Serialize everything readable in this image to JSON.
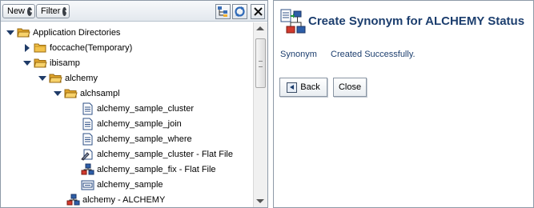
{
  "toolbar": {
    "new_label": "New",
    "filter_label": "Filter",
    "icons": [
      "tree-settings-icon",
      "refresh-icon",
      "close-icon"
    ]
  },
  "tree": {
    "items": [
      {
        "label": "Application Directories",
        "icon": "folder-open-icon",
        "twisty": "open"
      },
      {
        "label": "foccache(Temporary)",
        "icon": "folder-closed-icon",
        "twisty": "closed"
      },
      {
        "label": "ibisamp",
        "icon": "folder-open-icon",
        "twisty": "open"
      },
      {
        "label": "alchemy",
        "icon": "folder-open-icon",
        "twisty": "open"
      },
      {
        "label": "alchsampl",
        "icon": "folder-open-icon",
        "twisty": "open"
      },
      {
        "label": "alchemy_sample_cluster",
        "icon": "document-icon"
      },
      {
        "label": "alchemy_sample_join",
        "icon": "document-icon"
      },
      {
        "label": "alchemy_sample_where",
        "icon": "document-icon"
      },
      {
        "label": "alchemy_sample_cluster - Flat File",
        "icon": "flat-file-icon"
      },
      {
        "label": "alchemy_sample_fix - Flat File",
        "icon": "synonym-icon"
      },
      {
        "label": "alchemy_sample",
        "icon": "data-file-icon"
      },
      {
        "label": "alchemy - ALCHEMY",
        "icon": "synonym-icon"
      }
    ]
  },
  "dialog": {
    "title": "Create Synonym for ALCHEMY Status",
    "message_label": "Synonym",
    "message_text": "Created Successfully.",
    "back_label": "Back",
    "close_label": "Close"
  },
  "colors": {
    "title": "#1c3e6e",
    "folder": "#f2c24a",
    "border": "#8e9aa8"
  }
}
